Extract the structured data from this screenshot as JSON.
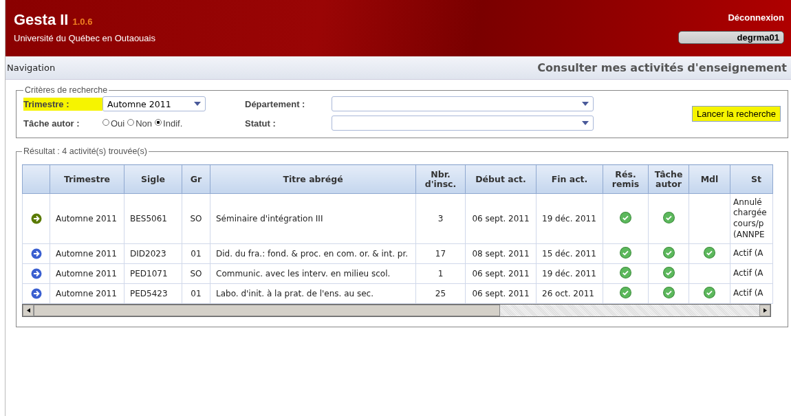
{
  "header": {
    "app_name": "Gesta II",
    "version": "1.0.6",
    "institution": "Université du Québec en Outaouais",
    "logout": "Déconnexion",
    "user": "degrma01"
  },
  "nav": {
    "label": "Navigation",
    "page_title": "Consulter mes activités d'enseignement"
  },
  "criteria": {
    "legend": "Critères de recherche",
    "term": {
      "label": "Trimestre :",
      "value": "Automne 2011",
      "highlighted": true
    },
    "task": {
      "label": "Tâche autor :",
      "options": [
        {
          "label": "Oui",
          "selected": false
        },
        {
          "label": "Non",
          "selected": false
        },
        {
          "label": "Indif.",
          "selected": true
        }
      ]
    },
    "department": {
      "label": "Département :"
    },
    "status": {
      "label": "Statut :"
    },
    "search_button": {
      "label": "Lancer la recherche",
      "highlighted": true
    }
  },
  "results": {
    "legend": "Résultat : 4 activité(s) trouvée(s)",
    "columns": [
      "Trimestre",
      "Sigle",
      "Gr",
      "Titre abrégé",
      "Nbr. d'insc.",
      "Début act.",
      "Fin act.",
      "Rés. remis",
      "Tâche autor",
      "Mdl",
      "St"
    ],
    "rows": [
      {
        "selected": true,
        "term": "Automne 2011",
        "code": "BES5061",
        "group": "SO",
        "title": "Séminaire d'intégration III",
        "enrolled": "3",
        "start": "06 sept. 2011",
        "end": "19 déc. 2011",
        "res_remis": true,
        "tache_autor": true,
        "mdl": false,
        "status": [
          "Annulé",
          "chargée",
          "cours/p",
          "(ANNPE"
        ]
      },
      {
        "selected": false,
        "term": "Automne 2011",
        "code": "DID2023",
        "group": "01",
        "title": "Did. du fra.: fond. & proc. en com. or. & int. pr.",
        "enrolled": "17",
        "start": "08 sept. 2011",
        "end": "15 déc. 2011",
        "res_remis": true,
        "tache_autor": true,
        "mdl": true,
        "status": [
          "Actif (A"
        ]
      },
      {
        "selected": false,
        "term": "Automne 2011",
        "code": "PED1071",
        "group": "SO",
        "title": "Communic. avec les interv. en milieu scol.",
        "enrolled": "1",
        "start": "06 sept. 2011",
        "end": "19 déc. 2011",
        "res_remis": true,
        "tache_autor": true,
        "mdl": false,
        "status": [
          "Actif (A"
        ]
      },
      {
        "selected": false,
        "term": "Automne 2011",
        "code": "PED5423",
        "group": "01",
        "title": "Labo. d'init. à la prat. de l'ens. au sec.",
        "enrolled": "25",
        "start": "06 sept. 2011",
        "end": "26 oct. 2011",
        "res_remis": true,
        "tache_autor": true,
        "mdl": true,
        "status": [
          "Actif (A"
        ]
      }
    ]
  }
}
